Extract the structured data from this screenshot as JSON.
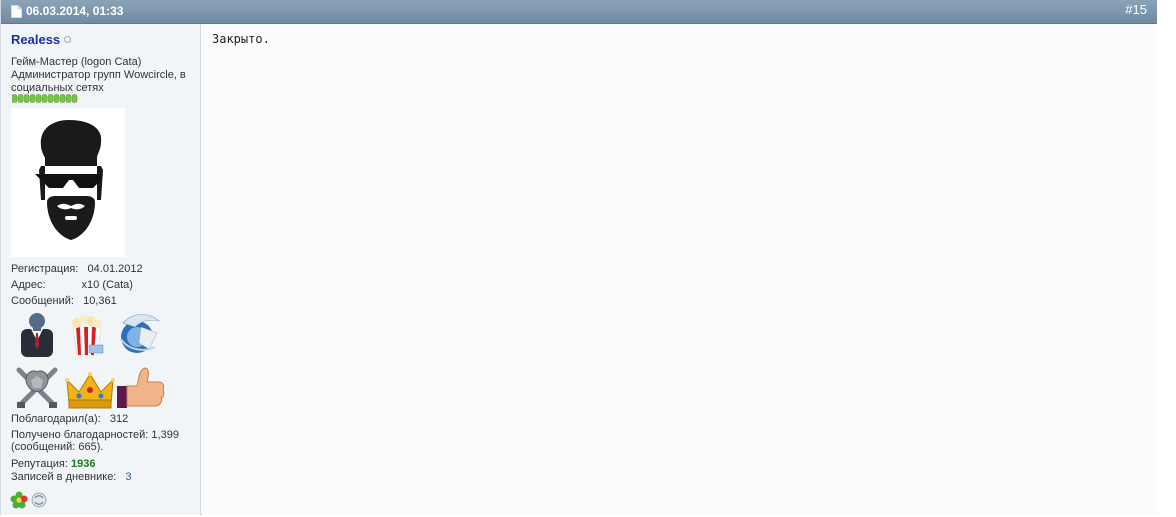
{
  "post": {
    "date": "06.03.2014, 01:33",
    "number": "#15",
    "message": "Закрыто."
  },
  "user": {
    "name": "Realess",
    "title_line1": "Гейм-Мастер (logon Cata)",
    "title_line2": "Администратор групп Wowcircle, в",
    "title_line3": "социальных сетях",
    "reg_label": "Регистрация:",
    "reg_value": "04.01.2012",
    "addr_label": "Адрес:",
    "addr_value": "x10 (Cata)",
    "posts_label": "Сообщений:",
    "posts_value": "10,361",
    "thanked_label": "Поблагодарил(а):",
    "thanked_value": "312",
    "received_line1": "Получено благодарностей: 1,399",
    "received_line2": "(сообщений: 665).",
    "rep_label": "Репутация:",
    "rep_value": "1936",
    "diary_label": "Записей в дневнике:",
    "diary_value": "3"
  },
  "colors": {
    "header": "#7b96ab",
    "username": "#1b2fa6",
    "reputation": "#1b7a1b"
  }
}
